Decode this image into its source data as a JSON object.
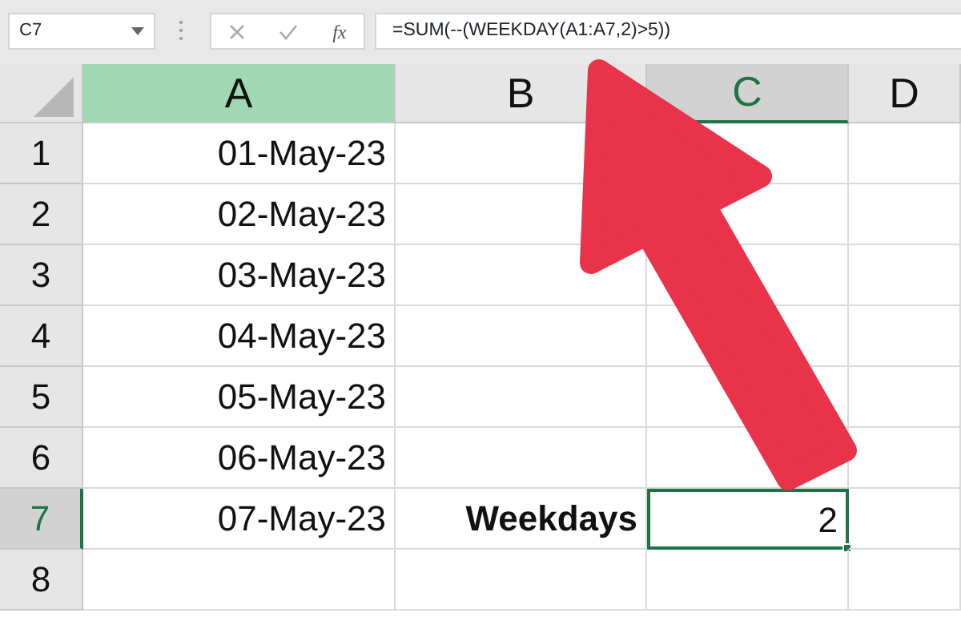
{
  "name_box": {
    "value": "C7"
  },
  "formula_bar": {
    "fx": "fx",
    "formula": "=SUM(--(WEEKDAY(A1:A7,2)>5))"
  },
  "columns": [
    {
      "label": "A",
      "highlighted": true,
      "selected": false
    },
    {
      "label": "B",
      "highlighted": false,
      "selected": false
    },
    {
      "label": "C",
      "highlighted": false,
      "selected": true
    },
    {
      "label": "D",
      "highlighted": false,
      "selected": false
    }
  ],
  "rows": [
    {
      "label": "1",
      "active": false,
      "cells": [
        {
          "text": "01-May-23"
        }
      ]
    },
    {
      "label": "2",
      "active": false,
      "cells": [
        {
          "text": "02-May-23"
        }
      ]
    },
    {
      "label": "3",
      "active": false,
      "cells": [
        {
          "text": "03-May-23"
        }
      ]
    },
    {
      "label": "4",
      "active": false,
      "cells": [
        {
          "text": "04-May-23"
        }
      ]
    },
    {
      "label": "5",
      "active": false,
      "cells": [
        {
          "text": "05-May-23"
        }
      ]
    },
    {
      "label": "6",
      "active": false,
      "cells": [
        {
          "text": "06-May-23"
        }
      ]
    },
    {
      "label": "7",
      "active": true,
      "cells": [
        {
          "text": "07-May-23"
        },
        {
          "text": "Weekdays",
          "bold": true
        },
        {
          "text": "2",
          "selected": true
        }
      ]
    },
    {
      "label": "8",
      "active": false
    }
  ]
}
